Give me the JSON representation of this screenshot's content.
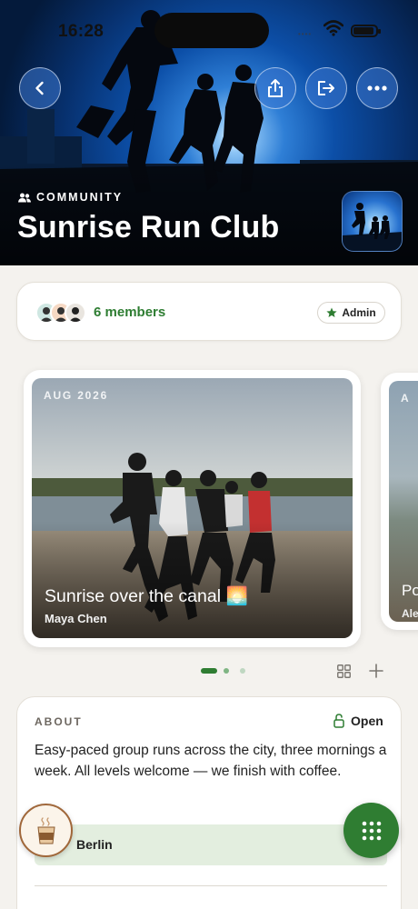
{
  "status_bar": {
    "time": "16:28",
    "signal_dots": "••••"
  },
  "header": {
    "category_label": "COMMUNITY",
    "title": "Sunrise Run Club",
    "buttons": [
      "back",
      "share",
      "leave",
      "more"
    ]
  },
  "members": {
    "count_label": "6 members",
    "role_badge": "Admin"
  },
  "gallery": {
    "items": [
      {
        "date": "AUG 2026",
        "title": "Sunrise over the canal 🌅",
        "author": "Maya Chen"
      },
      {
        "date": "A",
        "title": "Po",
        "author": "Ale"
      }
    ],
    "page_count": 3,
    "active_page": 1
  },
  "about": {
    "label": "ABOUT",
    "status": "Open",
    "description": "Easy-paced group runs across the city, three mornings a week. All levels welcome — we finish with coffee.",
    "location": "Berlin"
  },
  "colors": {
    "accent": "#2f7d32",
    "coffee_ring": "#a0673a"
  }
}
